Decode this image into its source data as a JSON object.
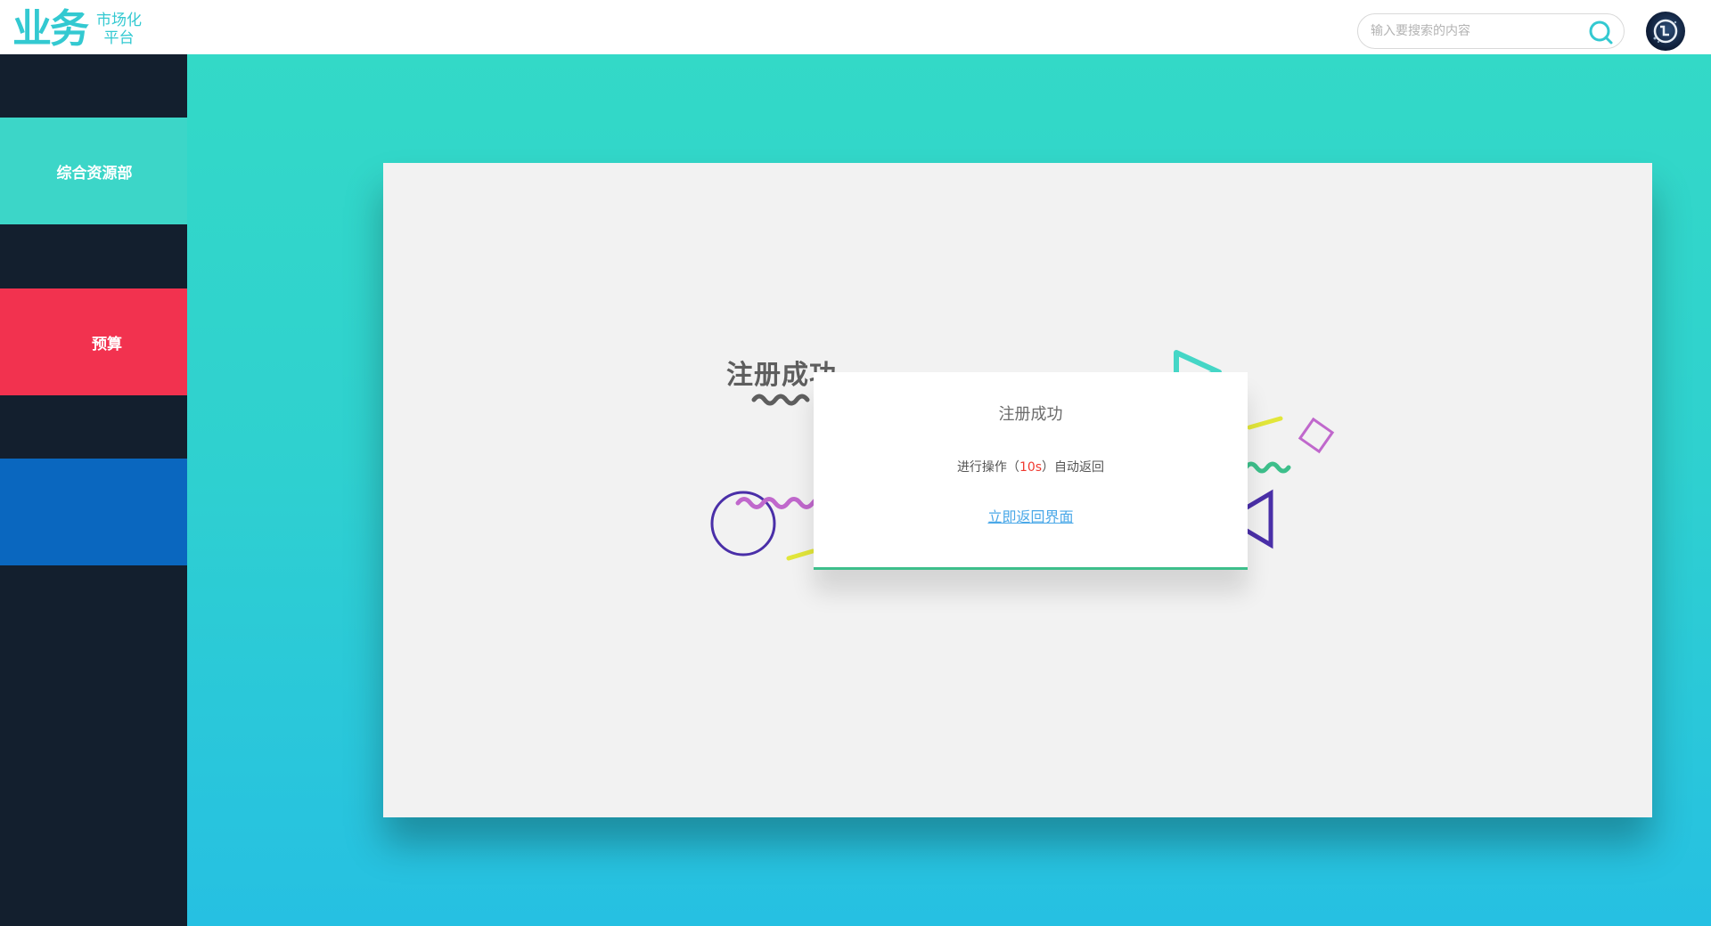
{
  "header": {
    "logo_main": "业务",
    "logo_sub_line1": "市场化",
    "logo_sub_line2": "平台",
    "search_placeholder": "输入要搜索的内容"
  },
  "sidebar": {
    "items": [
      {
        "label": "综合资源部",
        "color": "#3cd6c8"
      },
      {
        "label": "预算",
        "color": "#f2324f"
      },
      {
        "label": "",
        "color": "#0a67bf"
      }
    ]
  },
  "main": {
    "big_title": "注册成功",
    "dialog": {
      "title": "注册成功",
      "msg_prefix": "进行操作（",
      "countdown": "10s",
      "msg_suffix": "）自动返回",
      "link": "立即返回界面"
    }
  },
  "colors": {
    "accent": "#33c9d1",
    "sidebar_bg": "#131f2e",
    "countdown": "#f0392f",
    "link": "#4aa8e8",
    "dialog_border": "#3dbf8b"
  }
}
